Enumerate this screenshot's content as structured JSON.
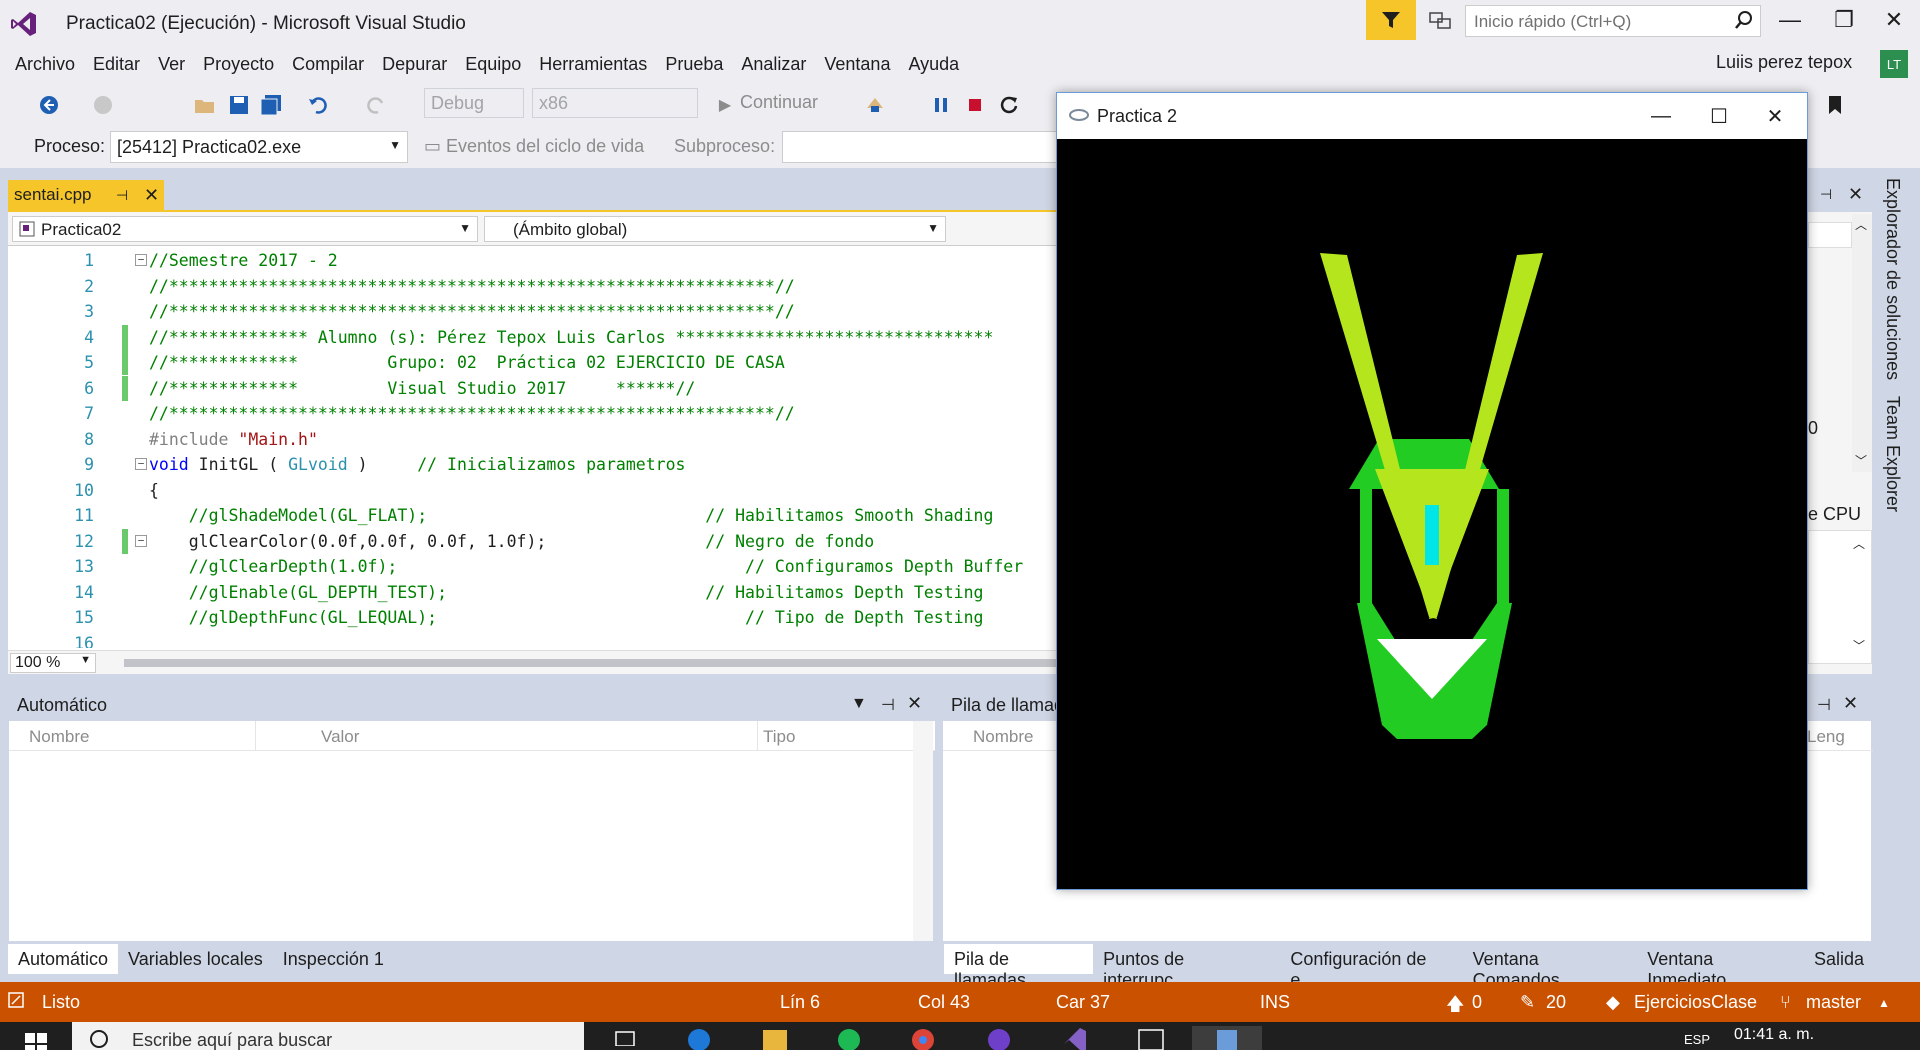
{
  "window": {
    "title": "Practica02 (Ejecución) - Microsoft Visual Studio",
    "quick_launch_placeholder": "Inicio rápido (Ctrl+Q)",
    "minimize": "—",
    "maximize": "❐",
    "close": "✕"
  },
  "menu": {
    "items": [
      "Archivo",
      "Editar",
      "Ver",
      "Proyecto",
      "Compilar",
      "Depurar",
      "Equipo",
      "Herramientas",
      "Prueba",
      "Analizar",
      "Ventana",
      "Ayuda"
    ],
    "user_name": "Luiis perez tepox",
    "user_initials": "LT"
  },
  "toolbar": {
    "config": "Debug",
    "platform": "x86",
    "continue": "Continuar",
    "process_label": "Proceso:",
    "process_value": "[25412] Practica02.exe",
    "lifecycle": "Eventos del ciclo de vida",
    "subprocess": "Subproceso:"
  },
  "editor": {
    "tab_name": "sentai.cpp",
    "project": "Practica02",
    "scope": "(Ámbito global)",
    "zoom": "100 %",
    "lines": [
      {
        "n": "1",
        "segments": [
          {
            "t": "//Semestre 2017 - 2",
            "c": "com"
          }
        ]
      },
      {
        "n": "2",
        "segments": [
          {
            "t": "//*************************************************************//",
            "c": "com"
          }
        ]
      },
      {
        "n": "3",
        "segments": [
          {
            "t": "//*************************************************************//",
            "c": "com"
          }
        ]
      },
      {
        "n": "4",
        "segments": [
          {
            "t": "//************** Alumno (s): Pérez Tepox Luis Carlos ********************************",
            "c": "com"
          }
        ]
      },
      {
        "n": "5",
        "segments": [
          {
            "t": "//*************         Grupo: 02  Práctica 02 EJERCICIO DE CASA",
            "c": "com"
          }
        ]
      },
      {
        "n": "6",
        "segments": [
          {
            "t": "//*************         Visual Studio 2017     ******//",
            "c": "com"
          }
        ]
      },
      {
        "n": "7",
        "segments": [
          {
            "t": "//*************************************************************//",
            "c": "com"
          }
        ]
      },
      {
        "n": "8",
        "segments": [
          {
            "t": "#include ",
            "c": "pp"
          },
          {
            "t": "\"Main.h\"",
            "c": "str"
          }
        ]
      },
      {
        "n": "9",
        "segments": [
          {
            "t": "void",
            "c": "kw"
          },
          {
            "t": " InitGL ( ",
            "c": "def"
          },
          {
            "t": "GLvoid",
            "c": "type"
          },
          {
            "t": " )     ",
            "c": "def"
          },
          {
            "t": "// Inicializamos parametros",
            "c": "com"
          }
        ]
      },
      {
        "n": "10",
        "segments": [
          {
            "t": "{",
            "c": "def"
          }
        ]
      },
      {
        "n": "11",
        "segments": [
          {
            "t": "    //glShadeModel(GL_FLAT);                            // Habilitamos Smooth Shading",
            "c": "com"
          }
        ]
      },
      {
        "n": "12",
        "segments": [
          {
            "t": "    glClearColor(0.0f,0.0f, 0.0f, 1.0f);                ",
            "c": "def"
          },
          {
            "t": "// Negro de fondo",
            "c": "com"
          }
        ]
      },
      {
        "n": "13",
        "segments": [
          {
            "t": "    //glClearDepth(1.0f);                                   // Configuramos Depth Buffer",
            "c": "com"
          }
        ]
      },
      {
        "n": "14",
        "segments": [
          {
            "t": "    //glEnable(GL_DEPTH_TEST);                          // Habilitamos Depth Testing",
            "c": "com"
          }
        ]
      },
      {
        "n": "15",
        "segments": [
          {
            "t": "    //glDepthFunc(GL_LEQUAL);                               // Tipo de Depth Testing",
            "c": "com"
          }
        ]
      },
      {
        "n": "16",
        "segments": []
      }
    ]
  },
  "side": {
    "solution_explorer": "Explorador de soluciones",
    "team_explorer": "Team Explorer",
    "cpu": "e CPU",
    "value_fragment": "0"
  },
  "autos": {
    "title": "Automático",
    "columns": [
      "Nombre",
      "Valor",
      "Tipo"
    ],
    "tabs": [
      "Automático",
      "Variables locales",
      "Inspección 1"
    ]
  },
  "callstack": {
    "title": "Pila de llamadas",
    "columns": [
      "Nombre",
      "Leng"
    ],
    "tabs": [
      "Pila de llamadas",
      "Puntos de interrupc...",
      "Configuración de e...",
      "Ventana Comandos",
      "Ventana Inmediato",
      "Salida"
    ]
  },
  "status": {
    "ready": "Listo",
    "line": "Lín 6",
    "col": "Col 43",
    "car": "Car 37",
    "ins": "INS",
    "up_count": "0",
    "pending_count": "20",
    "repo": "EjerciciosClase",
    "branch": "master"
  },
  "taskbar": {
    "search_placeholder": "Escribe aquí para buscar",
    "lang": "ESP",
    "time": "01:41 a. m."
  },
  "gl_window": {
    "title": "Practica 2",
    "minimize": "—",
    "maximize": "☐",
    "close": "✕"
  },
  "colors": {
    "accent": "#f5c52a",
    "statusbar": "#ca5100",
    "chrome": "#eeeef2",
    "panel": "#cfd6e5",
    "lime": "#b5e61d",
    "green": "#22cc22",
    "cyan": "#00e5e5"
  }
}
